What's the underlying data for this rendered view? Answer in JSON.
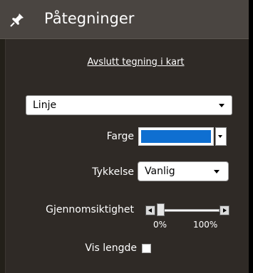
{
  "panel": {
    "title": "Påtegninger",
    "title_icon": "pin-icon"
  },
  "actions": {
    "end_drawing_link": "Avslutt tegning i kart"
  },
  "shape_select": {
    "value": "Linje"
  },
  "color": {
    "label": "Farge",
    "value": "#0f6fd1"
  },
  "thickness": {
    "label": "Tykkelse",
    "value": "Vanlig"
  },
  "transparency": {
    "label": "Gjennomsiktighet",
    "min_label": "0%",
    "max_label": "100%",
    "value_percent": 0
  },
  "show_length": {
    "label": "Vis lengde",
    "checked": false
  },
  "colors": {
    "panel_bg": "#2f2a26",
    "titlebar_bg": "#4a4541",
    "accent": "#0f6fd1"
  }
}
